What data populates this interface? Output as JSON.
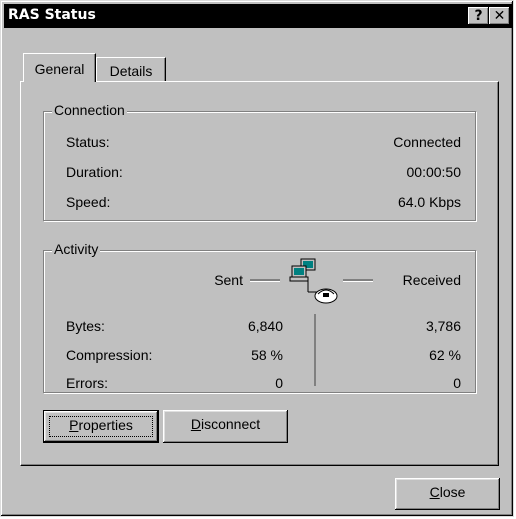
{
  "window": {
    "title": "RAS Status",
    "help_glyph": "?",
    "close_glyph": "✕"
  },
  "tabs": [
    {
      "label": "General",
      "selected": true
    },
    {
      "label": "Details",
      "selected": false
    }
  ],
  "connection": {
    "group_label": "Connection",
    "rows": [
      {
        "label": "Status:",
        "value": "Connected"
      },
      {
        "label": "Duration:",
        "value": "00:00:50"
      },
      {
        "label": "Speed:",
        "value": "64.0 Kbps"
      }
    ]
  },
  "activity": {
    "group_label": "Activity",
    "sent_label": "Sent",
    "received_label": "Received",
    "rows": [
      {
        "label": "Bytes:",
        "sent": "6,840",
        "received": "3,786"
      },
      {
        "label": "Compression:",
        "sent": "58 %",
        "received": "62 %"
      },
      {
        "label": "Errors:",
        "sent": "0",
        "received": "0"
      }
    ],
    "icon": "network-computers-icon"
  },
  "buttons": {
    "properties_first": "P",
    "properties_rest": "roperties",
    "disconnect_first": "D",
    "disconnect_rest": "isconnect",
    "close_first": "C",
    "close_rest": "lose"
  }
}
